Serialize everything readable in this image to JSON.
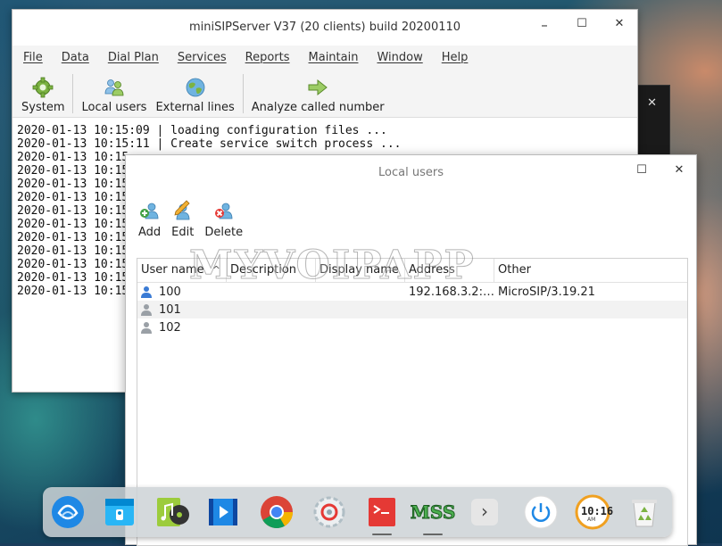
{
  "main_window": {
    "title": "miniSIPServer V37 (20 clients) build 20200110",
    "controls": {
      "minimize": "–",
      "maximize": "☐",
      "close": "✕"
    },
    "menu": [
      "File",
      "Data",
      "Dial Plan",
      "Services",
      "Reports",
      "Maintain",
      "Window",
      "Help"
    ],
    "toolbar": {
      "system": "System",
      "local_users": "Local users",
      "external_lines": "External lines",
      "analyze": "Analyze called number"
    },
    "log_lines": [
      "2020-01-13 10:15:09 | loading configuration files ...",
      "2020-01-13 10:15:11 | Create service switch process ...",
      "2020-01-13 10:15",
      "2020-01-13 10:15",
      "2020-01-13 10:15",
      "2020-01-13 10:15",
      "2020-01-13 10:15",
      "2020-01-13 10:15",
      "2020-01-13 10:15",
      "2020-01-13 10:15",
      "2020-01-13 10:15",
      "2020-01-13 10:15",
      "2020-01-13 10:15"
    ]
  },
  "bg_window": {
    "close": "✕"
  },
  "local_users_window": {
    "title": "Local users",
    "controls": {
      "maximize": "☐",
      "close": "✕"
    },
    "toolbar": {
      "add": "Add",
      "edit": "Edit",
      "delete": "Delete"
    },
    "columns": [
      "User name",
      "Description",
      "Display name",
      "Address",
      "Other"
    ],
    "sort_indicator": "^",
    "rows": [
      {
        "user": "100",
        "description": "",
        "display": "",
        "address": "192.168.3.2:5…",
        "other": "MicroSIP/3.19.21",
        "online": true
      },
      {
        "user": "101",
        "description": "",
        "display": "",
        "address": "",
        "other": "",
        "online": false
      },
      {
        "user": "102",
        "description": "",
        "display": "",
        "address": "",
        "other": "",
        "online": false
      }
    ]
  },
  "watermark": "MYVOIPAPP",
  "dock": {
    "items": [
      "deepin-launcher-icon",
      "file-manager-icon",
      "music-player-icon",
      "video-player-icon",
      "chrome-icon",
      "settings-icon",
      "terminal-icon",
      "minisipserver-icon",
      "chevron-right-icon",
      "power-icon",
      "clock-icon",
      "trash-icon"
    ],
    "clock_text": "10:16",
    "clock_ampm": "AM",
    "mss_label": "MSS",
    "expand": "›"
  },
  "colors": {
    "accent_green": "#6aa83a",
    "user_online": "#3a7bd5",
    "user_offline": "#9aa0a6"
  }
}
